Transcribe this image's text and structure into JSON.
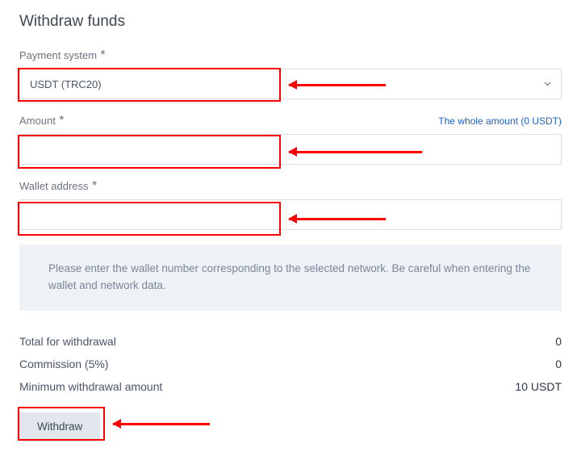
{
  "title": "Withdraw funds",
  "payment_system": {
    "label": "Payment system",
    "required_mark": "*",
    "value": "USDT (TRC20)"
  },
  "amount": {
    "label": "Amount",
    "required_mark": "*",
    "whole_link": "The whole amount (0 USDT)",
    "value": ""
  },
  "wallet": {
    "label": "Wallet address",
    "required_mark": "*",
    "value": ""
  },
  "info_text": "Please enter the wallet number corresponding to the selected network. Be careful when entering the wallet and network data.",
  "summary": {
    "total_label": "Total for withdrawal",
    "total_value": "0",
    "commission_label": "Commission (5%)",
    "commission_value": "0",
    "minimum_label": "Minimum withdrawal amount",
    "minimum_value": "10 USDT"
  },
  "withdraw_button": "Withdraw"
}
